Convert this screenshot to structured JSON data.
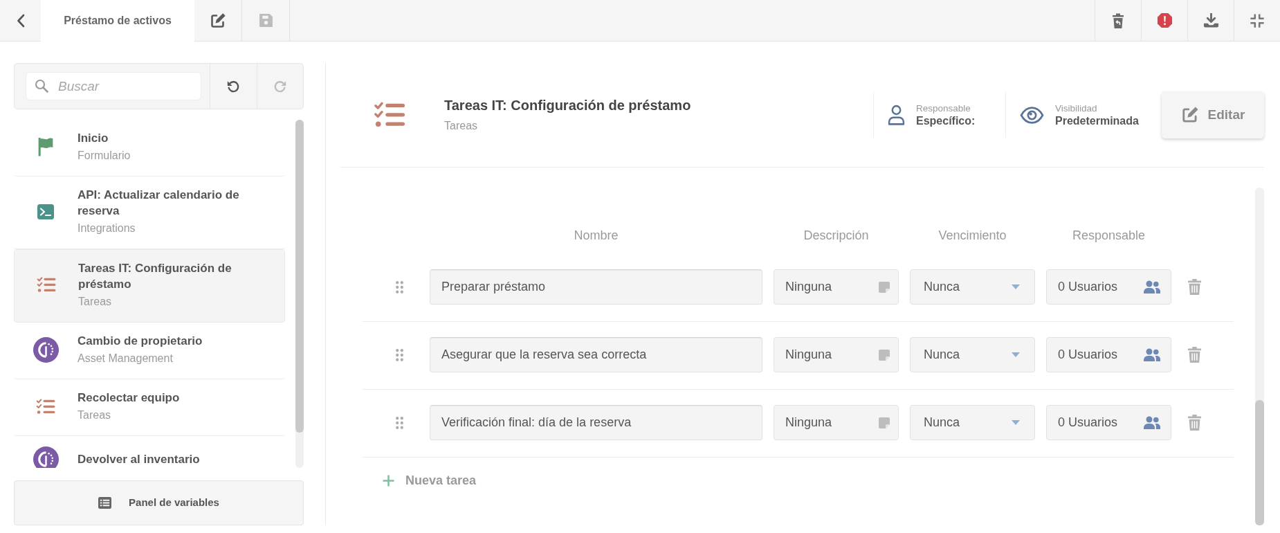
{
  "top_bar": {
    "tabs": [
      {
        "label": "Préstamo de activos",
        "selected": true
      }
    ],
    "tools": [
      {
        "kind": "edit",
        "disabled": false
      },
      {
        "kind": "save",
        "disabled": true
      }
    ],
    "actions": [
      {
        "kind": "restore"
      },
      {
        "kind": "alert"
      },
      {
        "kind": "download"
      },
      {
        "kind": "compress"
      }
    ]
  },
  "sidebar": {
    "search": {
      "placeholder": "Buscar"
    },
    "history": [
      {
        "kind": "undo",
        "disabled": false
      },
      {
        "kind": "redo",
        "disabled": true
      }
    ],
    "items": [
      {
        "kind": "form",
        "title": "Inicio",
        "subtitle": "Formulario",
        "selected": false
      },
      {
        "kind": "integration",
        "title": "API: Actualizar calendario de reserva",
        "subtitle": "Integrations",
        "selected": false
      },
      {
        "kind": "tasks",
        "title": "Tareas IT: Configuración de préstamo",
        "subtitle": "Tareas",
        "selected": true
      },
      {
        "kind": "asset",
        "title": "Cambio de propietario",
        "subtitle": "Asset Management",
        "selected": false
      },
      {
        "kind": "tasks",
        "title": "Recolectar equipo",
        "subtitle": "Tareas",
        "selected": false
      },
      {
        "kind": "asset",
        "title": "Devolver al inventario",
        "selected": false
      }
    ],
    "variables_button": "Panel de variables"
  },
  "task_header": {
    "kind": "tasks",
    "title": "Tareas IT: Configuración de préstamo",
    "subtitle": "Tareas",
    "meta": [
      {
        "kind": "assignee",
        "label": "Responsable",
        "value": "Específico:"
      },
      {
        "kind": "visibility",
        "label": "Visibilidad",
        "value": "Predeterminada"
      }
    ],
    "edit_button": "Editar"
  },
  "table": {
    "columns": [
      "Nombre",
      "Descripción",
      "Vencimiento",
      "Responsable"
    ],
    "rows": [
      {
        "name": "Preparar préstamo",
        "description": "Ninguna",
        "due": "Nunca",
        "assignees": "0 Usuarios"
      },
      {
        "name": "Asegurar que la reserva sea correcta",
        "description": "Ninguna",
        "due": "Nunca",
        "assignees": "0 Usuarios"
      },
      {
        "name": "Verificación final: día de la reserva",
        "description": "Ninguna",
        "due": "Nunca",
        "assignees": "0 Usuarios"
      }
    ],
    "add_button": "Nueva tarea"
  }
}
